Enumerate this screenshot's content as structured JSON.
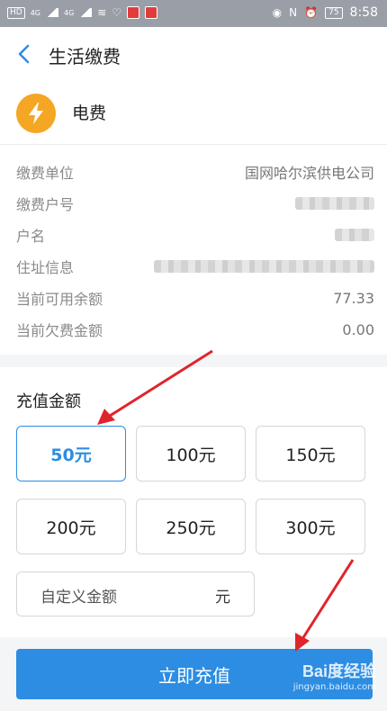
{
  "status_bar": {
    "left_badge": "HD",
    "network_1": "4G",
    "network_2": "4G",
    "battery": "75",
    "time": "8:58"
  },
  "header": {
    "title": "生活缴费"
  },
  "biller": {
    "name": "电费"
  },
  "info_rows": [
    {
      "label": "缴费单位",
      "value": "国网哈尔滨供电公司"
    },
    {
      "label": "缴费户号",
      "value": ""
    },
    {
      "label": "户名",
      "value": ""
    },
    {
      "label": "住址信息",
      "value": ""
    },
    {
      "label": "当前可用余额",
      "value": "77.33"
    },
    {
      "label": "当前欠费金额",
      "value": "0.00"
    }
  ],
  "recharge": {
    "title": "充值金额",
    "options": [
      "50元",
      "100元",
      "150元",
      "200元",
      "250元",
      "300元"
    ],
    "selected_index": 0,
    "custom_placeholder": "自定义金额",
    "custom_unit": "元"
  },
  "pay_button": {
    "label": "立即充值"
  },
  "watermark": {
    "brand": "Bai度经验",
    "url": "jingyan.baidu.com"
  },
  "colors": {
    "accent": "#2c8de3",
    "icon_bg": "#f5a623",
    "arrow": "#e0242b"
  }
}
